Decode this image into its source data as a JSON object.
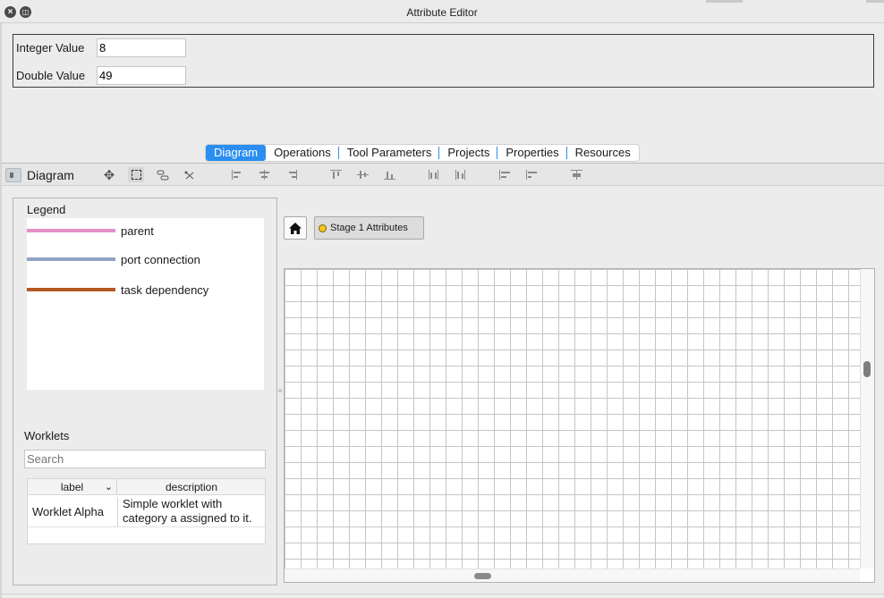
{
  "window": {
    "title": "Attribute Editor"
  },
  "attributes": [
    {
      "label": "Integer Value",
      "value": "8"
    },
    {
      "label": "Double Value",
      "value": "49"
    }
  ],
  "tabs": [
    {
      "label": "Diagram",
      "active": true
    },
    {
      "label": "Operations"
    },
    {
      "label": "Tool Parameters"
    },
    {
      "label": "Projects"
    },
    {
      "label": "Properties"
    },
    {
      "label": "Resources"
    }
  ],
  "toolbar": {
    "title": "Diagram",
    "icons": [
      "move-icon",
      "select-icon",
      "connect-icon",
      "delete-connection-icon",
      "align-left-icon",
      "align-center-icon",
      "align-right-icon",
      "align-top-icon",
      "align-middle-icon",
      "align-bottom-icon",
      "distribute-horizontal-icon",
      "distribute-vertical-icon",
      "same-width-icon",
      "same-height-icon",
      "layout-icon"
    ]
  },
  "legend": {
    "title": "Legend",
    "items": [
      {
        "name": "parent",
        "color": "#e58ec9"
      },
      {
        "name": "port connection",
        "color": "#8fa4c0"
      },
      {
        "name": "task dependency",
        "color": "#b35a22"
      }
    ]
  },
  "worklets": {
    "title": "Worklets",
    "search_placeholder": "Search",
    "columns": [
      "label",
      "description"
    ],
    "rows": [
      {
        "label": "Worklet Alpha",
        "description": "Simple worklet with category a assigned to it."
      }
    ]
  },
  "diagram": {
    "breadcrumb": "Stage 1 Attributes",
    "accent": "#2b8ef0"
  }
}
